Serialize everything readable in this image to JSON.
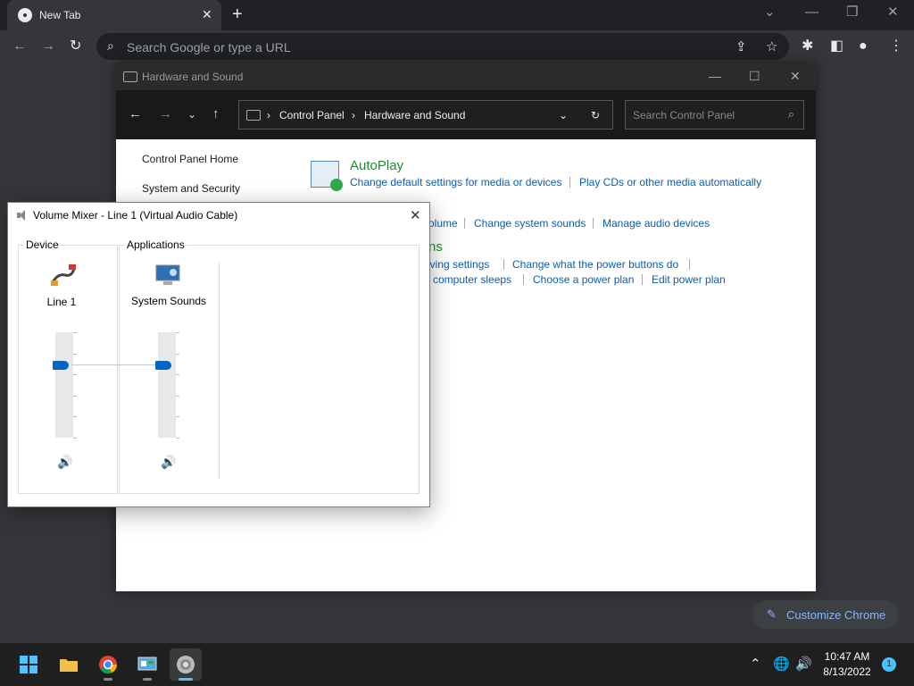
{
  "chrome": {
    "tab_title": "New Tab",
    "tab_close": "✕",
    "new_tab": "+",
    "window_buttons": [
      "⌄",
      "—",
      "❐",
      "✕"
    ],
    "omnibox_placeholder": "Search Google or type a URL",
    "customize_label": "Customize Chrome",
    "customize_icon": "✎"
  },
  "control_panel": {
    "title": "Hardware and Sound",
    "window_buttons": [
      "—",
      "☐",
      "✕"
    ],
    "breadcrumbs": [
      "Control Panel",
      "Hardware and Sound"
    ],
    "search_placeholder": "Search Control Panel",
    "sidebar": [
      "Control Panel Home",
      "System and Security"
    ],
    "autoplay": {
      "title": "AutoPlay",
      "links": [
        "Change default settings for media or devices",
        "Play CDs or other media automatically"
      ]
    },
    "sound_links": [
      "olume",
      "Change system sounds",
      "Manage audio devices"
    ],
    "power_title_fragment": "ns",
    "power_links_row1": [
      "aving settings",
      "Change what the power buttons do"
    ],
    "power_links_row2": [
      "e computer sleeps",
      "Choose a power plan",
      "Edit power plan"
    ]
  },
  "volume_mixer": {
    "title": "Volume Mixer - Line 1 (Virtual Audio Cable)",
    "close": "✕",
    "device_label": "Device",
    "applications_label": "Applications",
    "device_name": "Line 1",
    "app_name": "System Sounds",
    "device_volume": 0.7,
    "app_volume": 0.7,
    "mute_icon": "🔊"
  },
  "taskbar": {
    "time": "10:47 AM",
    "date": "8/13/2022",
    "notification_count": "1",
    "tray_chevron": "⌃",
    "tray_network": "🌐",
    "tray_volume": "🔊"
  }
}
